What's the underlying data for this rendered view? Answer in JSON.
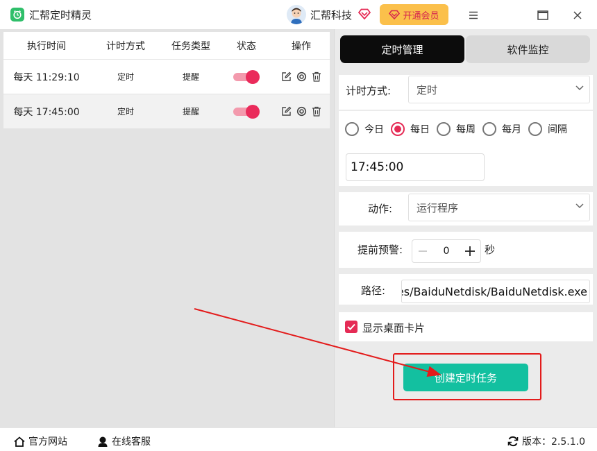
{
  "app": {
    "title": "汇帮定时精灵",
    "company": "汇帮科技",
    "vip_label": "开通会员"
  },
  "colors": {
    "accent": "#e52b55",
    "create_button": "#13c0a0",
    "vip_bg": "#fbc04b",
    "annotation": "#e31b1b"
  },
  "icons": [
    "app-logo-icon",
    "avatar-icon",
    "vip-diamond-icon",
    "menu-icon",
    "maximize-icon",
    "close-icon",
    "edit-icon",
    "settings-icon",
    "delete-icon",
    "chevron-down-icon",
    "minus-icon",
    "plus-icon",
    "check-icon",
    "home-icon",
    "support-icon",
    "refresh-icon"
  ],
  "table": {
    "headers": [
      "执行时间",
      "计时方式",
      "任务类型",
      "状态",
      "操作"
    ],
    "rows": [
      {
        "time": "每天 11:29:10",
        "mode": "定时",
        "type": "提醒",
        "enabled": true
      },
      {
        "time": "每天 17:45:00",
        "mode": "定时",
        "type": "提醒",
        "enabled": true
      }
    ]
  },
  "tabs": [
    "定时管理",
    "软件监控"
  ],
  "form": {
    "timing_label": "计时方式:",
    "timing_value": "定时",
    "frequency_options": [
      "今日",
      "每日",
      "每周",
      "每月",
      "间隔"
    ],
    "frequency_selected": "每日",
    "time_value": "17:45:00",
    "action_label": "动作:",
    "action_value": "运行程序",
    "advance_label": "提前预警:",
    "advance_value": "0",
    "advance_unit": "秒",
    "path_label": "路径:",
    "path_value": "C:/Program Files/BaiduNetdisk/BaiduNetdisk.exe",
    "show_card_label": "显示桌面卡片",
    "show_card_checked": true,
    "create_button": "创建定时任务"
  },
  "footer": {
    "website": "官方网站",
    "support": "在线客服",
    "version": "版本：2.5.1.0"
  }
}
